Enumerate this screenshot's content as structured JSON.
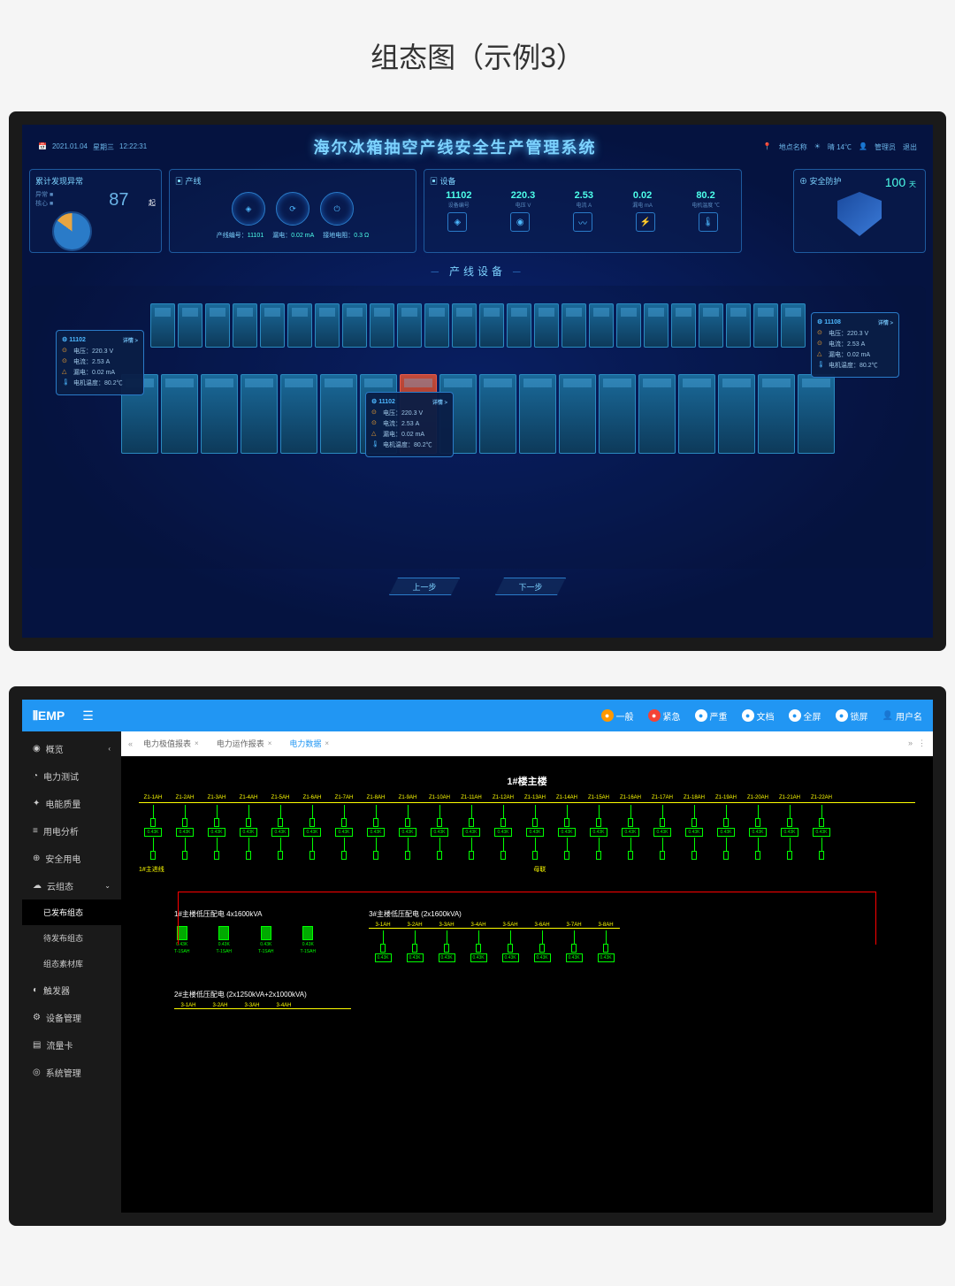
{
  "page_title": "组态图（示例3）",
  "screen1": {
    "header": {
      "date": "2021.01.04",
      "weekday": "星期三",
      "time": "12:22:31",
      "title": "海尔冰箱抽空产线安全生产管理系统",
      "location_label": "地点名称",
      "weather": "晴 14℃",
      "user": "管理员",
      "logout": "退出"
    },
    "panels": {
      "anomaly": {
        "title": "累计发现异常",
        "count": "87",
        "unit": "起",
        "sub1": "异常",
        "sub2": "核心"
      },
      "line": {
        "title": "产线",
        "line_no_label": "产线编号：",
        "line_no": "11101",
        "leak_label": "漏电：",
        "leak": "0.02 mA",
        "ground_label": "接地电阻：",
        "ground": "0.3 Ω"
      },
      "device": {
        "title": "设备",
        "metrics": [
          {
            "value": "11102",
            "label": "设备编号",
            "unit": ""
          },
          {
            "value": "220.3",
            "label": "电压",
            "unit": "V"
          },
          {
            "value": "2.53",
            "label": "电流",
            "unit": "A"
          },
          {
            "value": "0.02",
            "label": "漏电",
            "unit": "mA"
          },
          {
            "value": "80.2",
            "label": "电机温度",
            "unit": "℃"
          }
        ]
      },
      "safety": {
        "title": "安全防护",
        "days": "100",
        "unit": "天"
      }
    },
    "subtitle": "产线设备",
    "info_boxes": [
      {
        "id": "11102",
        "detail": "详情 >",
        "voltage": "电压：220.3 V",
        "current": "电流：2.53 A",
        "leak": "漏电：0.02 mA",
        "temp": "电机温度：80.2℃"
      },
      {
        "id": "11102",
        "detail": "详情 >",
        "voltage": "电压：220.3 V",
        "current": "电流：2.53 A",
        "leak": "漏电：0.02 mA",
        "temp": "电机温度：80.2℃"
      },
      {
        "id": "11108",
        "detail": "详情 >",
        "voltage": "电压：220.3 V",
        "current": "电流：2.53 A",
        "leak": "漏电：0.02 mA",
        "temp": "电机温度：80.2℃"
      }
    ],
    "nav": {
      "prev": "上一步",
      "next": "下一步"
    }
  },
  "screen2": {
    "logo": "EMP",
    "topbar": {
      "actions": [
        {
          "label": "一般",
          "color": "orange"
        },
        {
          "label": "紧急",
          "color": "red"
        },
        {
          "label": "严重",
          "color": "white"
        },
        {
          "label": "文档",
          "color": "white"
        },
        {
          "label": "全屏",
          "color": "white"
        },
        {
          "label": "锁屏",
          "color": "white"
        }
      ],
      "user": "用户名"
    },
    "sidebar": [
      {
        "icon": "◉",
        "label": "概览",
        "arrow": "‹"
      },
      {
        "icon": "◔",
        "label": "电力测试"
      },
      {
        "icon": "✦",
        "label": "电能质量"
      },
      {
        "icon": "≡",
        "label": "用电分析"
      },
      {
        "icon": "⊕",
        "label": "安全用电"
      },
      {
        "icon": "☁",
        "label": "云组态",
        "arrow": "⌄",
        "expanded": true
      },
      {
        "label": "已发布组态",
        "sub": true,
        "active": true
      },
      {
        "label": "待发布组态",
        "sub": true
      },
      {
        "label": "组态素材库",
        "sub": true
      },
      {
        "icon": "◐",
        "label": "触发器"
      },
      {
        "icon": "⚙",
        "label": "设备管理"
      },
      {
        "icon": "▤",
        "label": "流量卡"
      },
      {
        "icon": "◎",
        "label": "系统管理"
      }
    ],
    "tabs": [
      {
        "label": "电力极值报表",
        "active": false
      },
      {
        "label": "电力运作报表",
        "active": false
      },
      {
        "label": "电力数据",
        "active": true
      }
    ],
    "diagram": {
      "title1": "1#楼主楼",
      "bus_labels": [
        "Z1-1AH",
        "Z1-2AH",
        "Z1-3AH",
        "Z1-4AH",
        "Z1-5AH",
        "Z1-6AH",
        "Z1-7AH",
        "Z1-8AH",
        "Z1-9AH",
        "Z1-10AH",
        "Z1-11AH",
        "Z1-12AH",
        "Z1-13AH",
        "Z1-14AH",
        "Z1-15AH",
        "Z1-16AH",
        "Z1-17AH",
        "Z1-18AH",
        "Z1-19AH",
        "Z1-20AH",
        "Z1-21AH",
        "Z1-22AH"
      ],
      "value_sample": "0.43K",
      "bus_left": "1#主进线",
      "bus_mid": "母联",
      "section2_title": "1#主楼低压配电 4x1600kVA",
      "section3_title": "3#主楼低压配电 (2x1600kVA)",
      "section3_labels": [
        "3-1AH",
        "3-2AH",
        "3-3AH",
        "3-4AH",
        "3-5AH",
        "3-6AH",
        "3-7AH",
        "3-8AH"
      ],
      "xfmr_label": "T-1SAH",
      "xfmr_val": "0.43K",
      "section4_title": "2#主楼低压配电 (2x1250kVA+2x1000kVA)",
      "section4_labels": [
        "3-1AH",
        "3-2AH",
        "3-3AH",
        "3-4AH"
      ]
    }
  }
}
